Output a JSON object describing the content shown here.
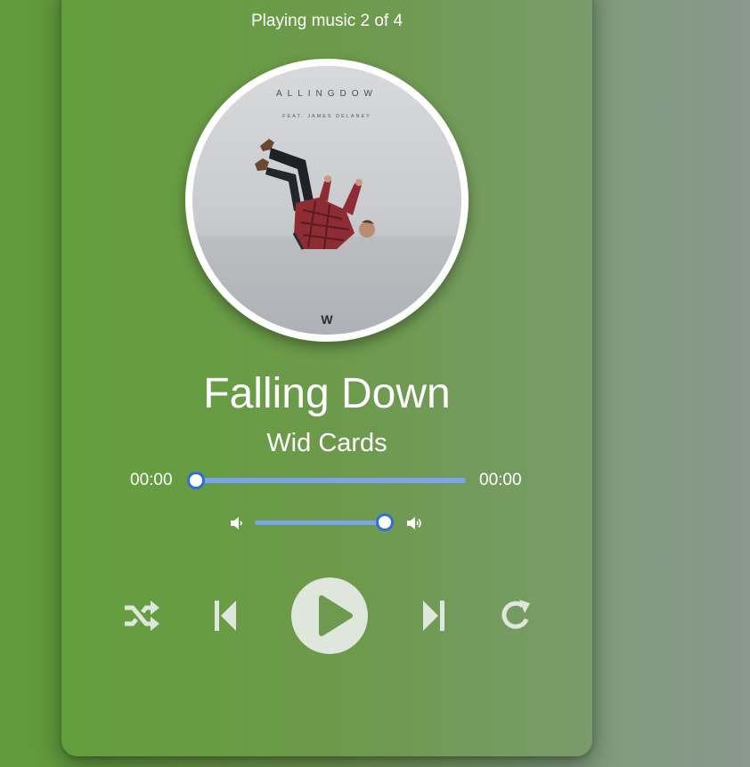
{
  "player": {
    "details_text": "Playing music 2 of 4",
    "track_name": "Falling Down",
    "track_artist": "Wid Cards",
    "current_time": "00:00",
    "total_duration": "00:00",
    "seek_fraction": 0.0,
    "volume_fraction": 1.0
  },
  "album_art": {
    "title_text": "ALLINGDOW",
    "subtitle_text": "FEAT. JAMES DELANEY",
    "logo_text": "W"
  },
  "controls": {
    "icons": [
      "volume-down-icon",
      "volume-up-icon",
      "shuffle-icon",
      "previous-icon",
      "play-icon",
      "next-icon",
      "repeat-icon"
    ]
  },
  "colors": {
    "accent": "#2f6de0",
    "slider_track": "#7aa5ec",
    "control_icon": "#dfe6dc"
  }
}
